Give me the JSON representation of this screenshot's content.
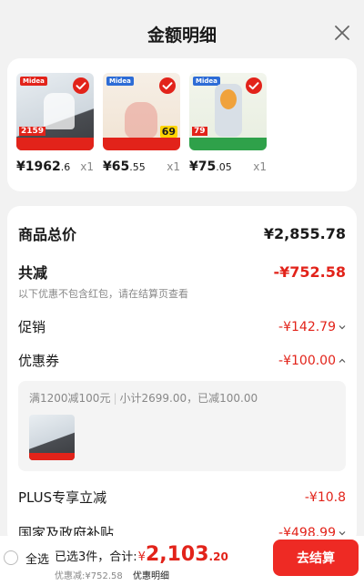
{
  "header": {
    "title": "金额明细"
  },
  "products": [
    {
      "price_main": "¥1962",
      "price_decimal": ".6",
      "qty": "x1",
      "badge": "Midea",
      "tag": "2159",
      "photo": "range-hood-product-photo"
    },
    {
      "price_main": "¥65",
      "price_decimal": ".55",
      "qty": "x1",
      "badge": "Midea",
      "tag": "69",
      "photo": "food-chopper-product-photo"
    },
    {
      "price_main": "¥75",
      "price_decimal": ".05",
      "qty": "x1",
      "badge": "Midea",
      "tag": "79",
      "photo": "blender-product-photo"
    }
  ],
  "detail": {
    "total_label": "商品总价",
    "total_value": "¥2,855.78",
    "reduce_label": "共减",
    "reduce_value": "-¥752.58",
    "reduce_note": "以下优惠不包含红包，请在结算页查看",
    "promo_label": "促销",
    "promo_value": "-¥142.79",
    "coupon_label": "优惠券",
    "coupon_value": "-¥100.00",
    "coupon_rule": "满1200减100元",
    "coupon_calc": "小计2699.00，已减100.00",
    "plus_label": "PLUS专享立减",
    "plus_value": "-¥10.8",
    "gov_label": "国家及政府补贴",
    "gov_value": "-¥498.99"
  },
  "footer": {
    "select_all": "全选",
    "selected_text": "已选3件，合计:",
    "currency": "¥",
    "total_int": "2,103",
    "total_dec": ".20",
    "discount_text": "优惠减:¥752.58",
    "detail_link": "优惠明细",
    "checkout": "去结算"
  },
  "colors": {
    "accent": "#e2231a",
    "button": "#ee2a24"
  }
}
